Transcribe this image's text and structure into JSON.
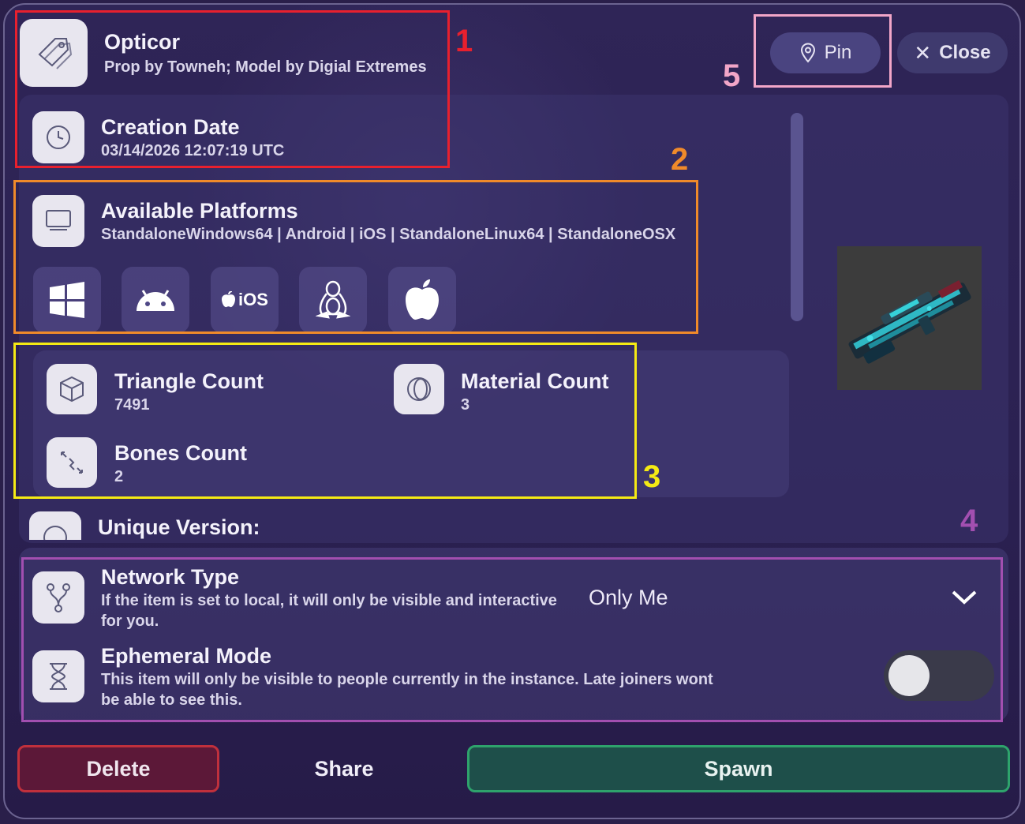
{
  "header": {
    "item_name": "Opticor",
    "item_credit": "Prop by Towneh; Model by Digial Extremes",
    "pin_label": "Pin",
    "close_label": "Close"
  },
  "creation": {
    "label": "Creation Date",
    "value": "03/14/2026 12:07:19 UTC"
  },
  "platforms": {
    "label": "Available Platforms",
    "value": "StandaloneWindows64 | Android | iOS | StandaloneLinux64 | StandaloneOSX",
    "icons": [
      "windows-icon",
      "android-icon",
      "ios-icon",
      "linux-icon",
      "apple-icon"
    ],
    "ios_text": "iOS"
  },
  "stats": {
    "triangle_label": "Triangle Count",
    "triangle_value": "7491",
    "material_label": "Material Count",
    "material_value": "3",
    "bones_label": "Bones Count",
    "bones_value": "2"
  },
  "unique_version": {
    "label": "Unique Version:"
  },
  "network": {
    "label": "Network Type",
    "description": "If the item is set to local, it will only be visible and interactive for you.",
    "selected": "Only Me"
  },
  "ephemeral": {
    "label": "Ephemeral Mode",
    "description": "This item will only be visible to people currently in the instance. Late joiners wont be able to see this.",
    "enabled": false
  },
  "actions": {
    "delete_label": "Delete",
    "share_label": "Share",
    "spawn_label": "Spawn"
  },
  "annotations": {
    "n1": "1",
    "n2": "2",
    "n3": "3",
    "n4": "4",
    "n5": "5",
    "colors": {
      "n1": "#e8202e",
      "n2": "#f08a2a",
      "n3": "#f5ea14",
      "n4": "#a24fb0",
      "n5": "#f2a6c8"
    }
  }
}
